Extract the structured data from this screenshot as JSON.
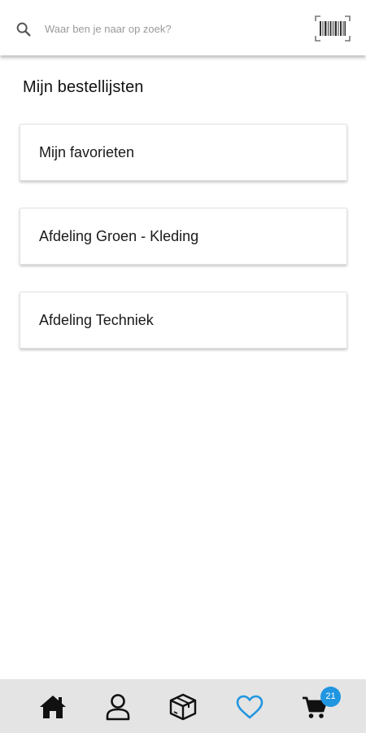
{
  "search": {
    "placeholder": "Waar ben je naar op zoek?",
    "icon": "search-icon",
    "scanner_icon": "barcode-scanner-icon"
  },
  "page": {
    "title": "Mijn bestellijsten"
  },
  "order_lists": [
    {
      "label": "Mijn favorieten"
    },
    {
      "label": "Afdeling Groen - Kleding"
    },
    {
      "label": "Afdeling Techniek"
    }
  ],
  "bottom_nav": {
    "items": [
      {
        "name": "home",
        "icon": "home-icon",
        "active": false
      },
      {
        "name": "account",
        "icon": "user-icon",
        "active": false
      },
      {
        "name": "orders",
        "icon": "box-icon",
        "active": false
      },
      {
        "name": "favorites",
        "icon": "heart-icon",
        "active": true
      },
      {
        "name": "cart",
        "icon": "cart-icon",
        "active": false
      }
    ],
    "cart_count": "21"
  },
  "colors": {
    "accent": "#2196e0",
    "nav_background": "#e4e4e4",
    "icon_default": "#111111"
  }
}
